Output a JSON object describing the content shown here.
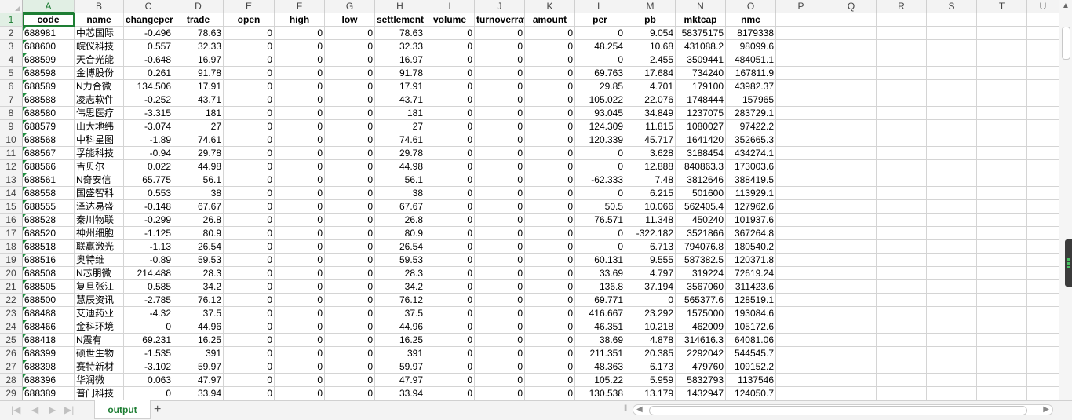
{
  "column_letters": [
    "A",
    "B",
    "C",
    "D",
    "E",
    "F",
    "G",
    "H",
    "I",
    "J",
    "K",
    "L",
    "M",
    "N",
    "O",
    "P",
    "Q",
    "R",
    "S",
    "T",
    "U"
  ],
  "headers": [
    "code",
    "name",
    "changepercent",
    "trade",
    "open",
    "high",
    "low",
    "settlement",
    "volume",
    "turnoverratio",
    "amount",
    "per",
    "pb",
    "mktcap",
    "nmc"
  ],
  "rows": [
    [
      "688981",
      "中芯国际",
      "-0.496",
      "78.63",
      "0",
      "0",
      "0",
      "78.63",
      "0",
      "0",
      "0",
      "0",
      "9.054",
      "58375175",
      "8179338"
    ],
    [
      "688600",
      "皖仪科技",
      "0.557",
      "32.33",
      "0",
      "0",
      "0",
      "32.33",
      "0",
      "0",
      "0",
      "48.254",
      "10.68",
      "431088.2",
      "98099.6"
    ],
    [
      "688599",
      "天合光能",
      "-0.648",
      "16.97",
      "0",
      "0",
      "0",
      "16.97",
      "0",
      "0",
      "0",
      "0",
      "2.455",
      "3509441",
      "484051.1"
    ],
    [
      "688598",
      "金博股份",
      "0.261",
      "91.78",
      "0",
      "0",
      "0",
      "91.78",
      "0",
      "0",
      "0",
      "69.763",
      "17.684",
      "734240",
      "167811.9"
    ],
    [
      "688589",
      "N力合微",
      "134.506",
      "17.91",
      "0",
      "0",
      "0",
      "17.91",
      "0",
      "0",
      "0",
      "29.85",
      "4.701",
      "179100",
      "43982.37"
    ],
    [
      "688588",
      "凌志软件",
      "-0.252",
      "43.71",
      "0",
      "0",
      "0",
      "43.71",
      "0",
      "0",
      "0",
      "105.022",
      "22.076",
      "1748444",
      "157965"
    ],
    [
      "688580",
      "伟思医疗",
      "-3.315",
      "181",
      "0",
      "0",
      "0",
      "181",
      "0",
      "0",
      "0",
      "93.045",
      "34.849",
      "1237075",
      "283729.1"
    ],
    [
      "688579",
      "山大地纬",
      "-3.074",
      "27",
      "0",
      "0",
      "0",
      "27",
      "0",
      "0",
      "0",
      "124.309",
      "11.815",
      "1080027",
      "97422.2"
    ],
    [
      "688568",
      "中科星图",
      "-1.89",
      "74.61",
      "0",
      "0",
      "0",
      "74.61",
      "0",
      "0",
      "0",
      "120.339",
      "45.717",
      "1641420",
      "352665.3"
    ],
    [
      "688567",
      "孚能科技",
      "-0.94",
      "29.78",
      "0",
      "0",
      "0",
      "29.78",
      "0",
      "0",
      "0",
      "0",
      "3.628",
      "3188454",
      "434274.1"
    ],
    [
      "688566",
      "吉贝尔",
      "0.022",
      "44.98",
      "0",
      "0",
      "0",
      "44.98",
      "0",
      "0",
      "0",
      "0",
      "12.888",
      "840863.3",
      "173003.6"
    ],
    [
      "688561",
      "N奇安信",
      "65.775",
      "56.1",
      "0",
      "0",
      "0",
      "56.1",
      "0",
      "0",
      "0",
      "-62.333",
      "7.48",
      "3812646",
      "388419.5"
    ],
    [
      "688558",
      "国盛智科",
      "0.553",
      "38",
      "0",
      "0",
      "0",
      "38",
      "0",
      "0",
      "0",
      "0",
      "6.215",
      "501600",
      "113929.1"
    ],
    [
      "688555",
      "泽达易盛",
      "-0.148",
      "67.67",
      "0",
      "0",
      "0",
      "67.67",
      "0",
      "0",
      "0",
      "50.5",
      "10.066",
      "562405.4",
      "127962.6"
    ],
    [
      "688528",
      "秦川物联",
      "-0.299",
      "26.8",
      "0",
      "0",
      "0",
      "26.8",
      "0",
      "0",
      "0",
      "76.571",
      "11.348",
      "450240",
      "101937.6"
    ],
    [
      "688520",
      "神州细胞",
      "-1.125",
      "80.9",
      "0",
      "0",
      "0",
      "80.9",
      "0",
      "0",
      "0",
      "0",
      "-322.182",
      "3521866",
      "367264.8"
    ],
    [
      "688518",
      "联赢激光",
      "-1.13",
      "26.54",
      "0",
      "0",
      "0",
      "26.54",
      "0",
      "0",
      "0",
      "0",
      "6.713",
      "794076.8",
      "180540.2"
    ],
    [
      "688516",
      "奥特维",
      "-0.89",
      "59.53",
      "0",
      "0",
      "0",
      "59.53",
      "0",
      "0",
      "0",
      "60.131",
      "9.555",
      "587382.5",
      "120371.8"
    ],
    [
      "688508",
      "N芯朋微",
      "214.488",
      "28.3",
      "0",
      "0",
      "0",
      "28.3",
      "0",
      "0",
      "0",
      "33.69",
      "4.797",
      "319224",
      "72619.24"
    ],
    [
      "688505",
      "复旦张江",
      "0.585",
      "34.2",
      "0",
      "0",
      "0",
      "34.2",
      "0",
      "0",
      "0",
      "136.8",
      "37.194",
      "3567060",
      "311423.6"
    ],
    [
      "688500",
      "慧辰资讯",
      "-2.785",
      "76.12",
      "0",
      "0",
      "0",
      "76.12",
      "0",
      "0",
      "0",
      "69.771",
      "0",
      "565377.6",
      "128519.1"
    ],
    [
      "688488",
      "艾迪药业",
      "-4.32",
      "37.5",
      "0",
      "0",
      "0",
      "37.5",
      "0",
      "0",
      "0",
      "416.667",
      "23.292",
      "1575000",
      "193084.6"
    ],
    [
      "688466",
      "金科环境",
      "0",
      "44.96",
      "0",
      "0",
      "0",
      "44.96",
      "0",
      "0",
      "0",
      "46.351",
      "10.218",
      "462009",
      "105172.6"
    ],
    [
      "688418",
      "N震有",
      "69.231",
      "16.25",
      "0",
      "0",
      "0",
      "16.25",
      "0",
      "0",
      "0",
      "38.69",
      "4.878",
      "314616.3",
      "64081.06"
    ],
    [
      "688399",
      "硕世生物",
      "-1.535",
      "391",
      "0",
      "0",
      "0",
      "391",
      "0",
      "0",
      "0",
      "211.351",
      "20.385",
      "2292042",
      "544545.7"
    ],
    [
      "688398",
      "赛特新材",
      "-3.102",
      "59.97",
      "0",
      "0",
      "0",
      "59.97",
      "0",
      "0",
      "0",
      "48.363",
      "6.173",
      "479760",
      "109152.2"
    ],
    [
      "688396",
      "华润微",
      "0.063",
      "47.97",
      "0",
      "0",
      "0",
      "47.97",
      "0",
      "0",
      "0",
      "105.22",
      "5.959",
      "5832793",
      "1137546"
    ],
    [
      "688389",
      "普门科技",
      "0",
      "33.94",
      "0",
      "0",
      "0",
      "33.94",
      "0",
      "0",
      "0",
      "130.538",
      "13.179",
      "1432947",
      "124050.7"
    ]
  ],
  "sheet_tab": "output",
  "add_sheet_symbol": "+"
}
